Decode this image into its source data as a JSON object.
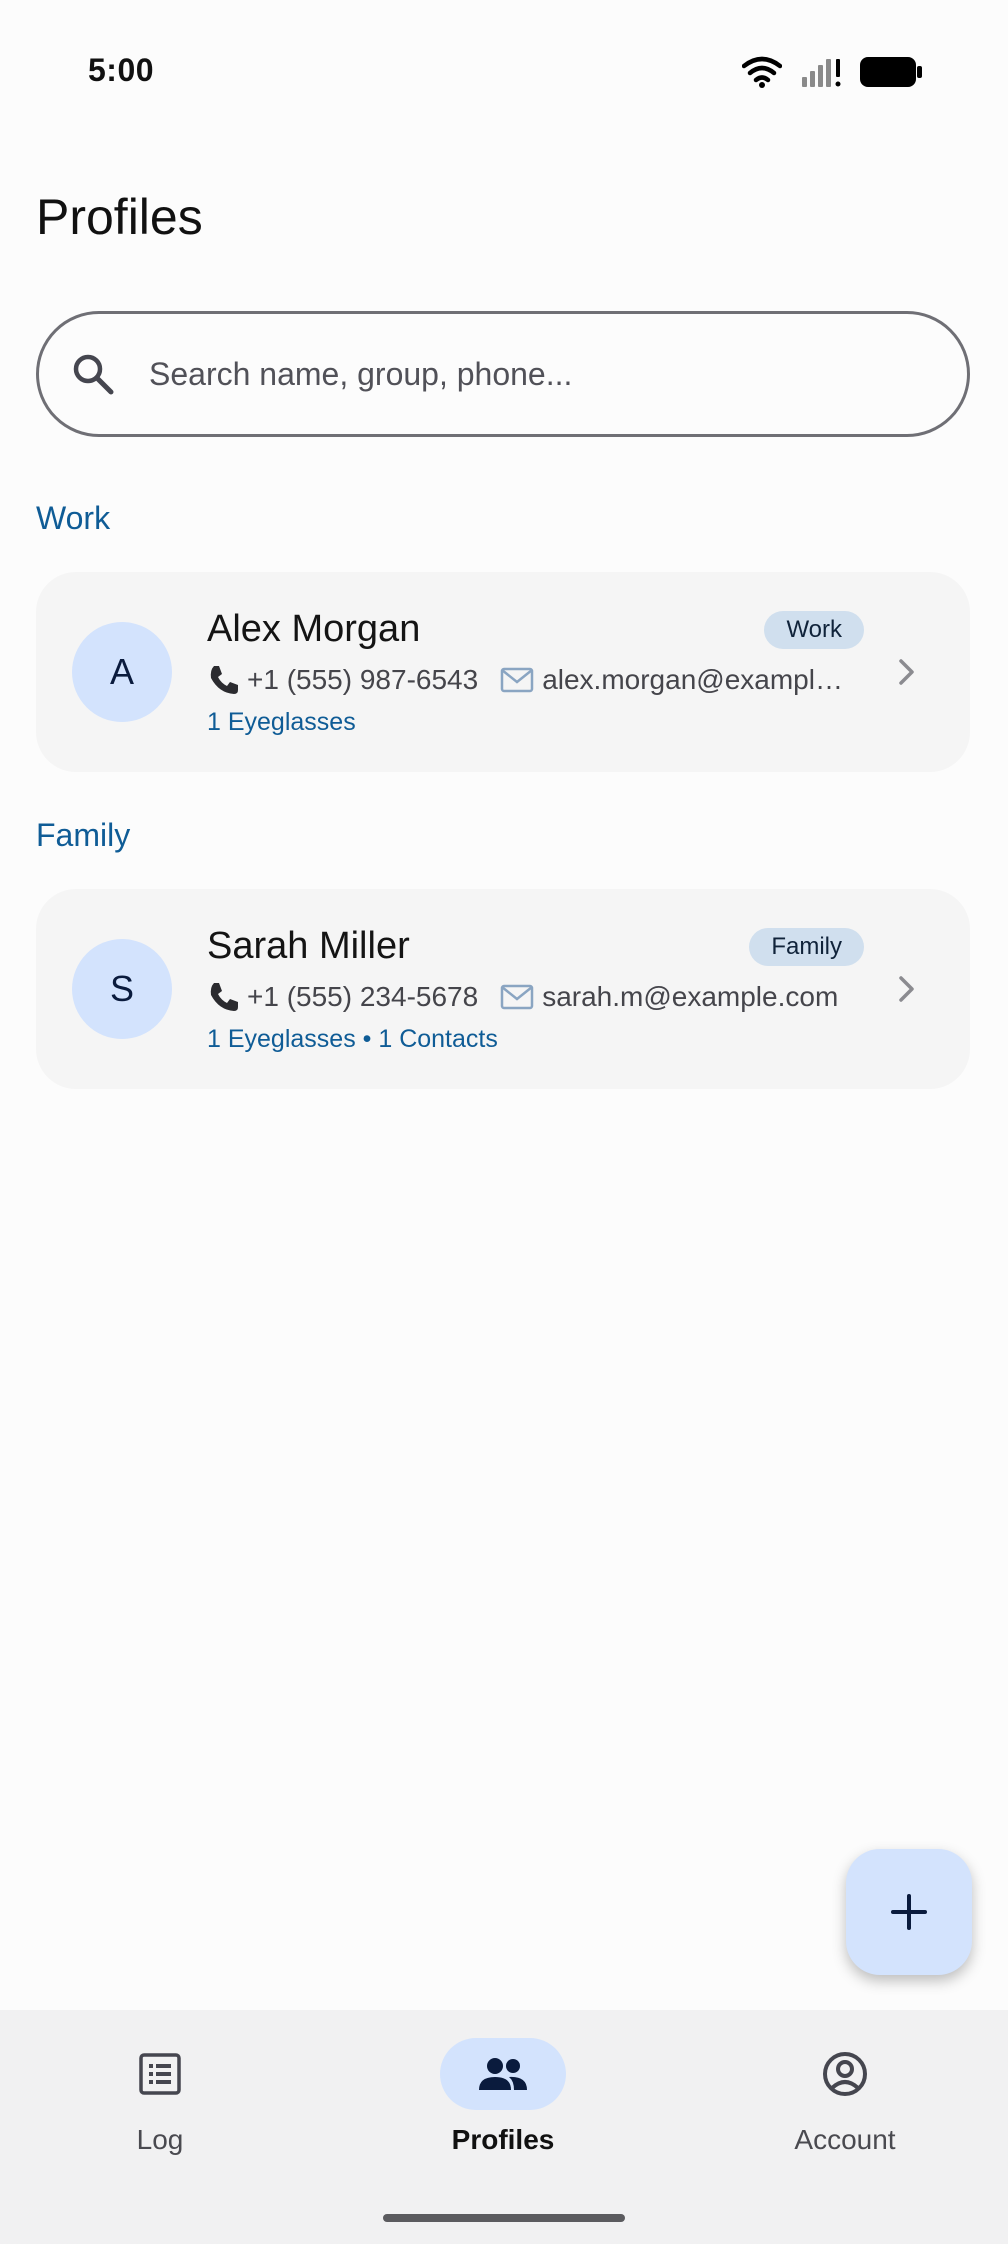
{
  "status_bar": {
    "time": "5:00"
  },
  "page": {
    "title": "Profiles"
  },
  "search": {
    "placeholder": "Search name, group, phone..."
  },
  "groups": [
    {
      "title": "Work",
      "profiles": [
        {
          "initial": "A",
          "name": "Alex Morgan",
          "badge": "Work",
          "phone": "+1 (555) 987-6543",
          "email": "alex.morgan@example.com",
          "summary": "1 Eyeglasses"
        }
      ]
    },
    {
      "title": "Family",
      "profiles": [
        {
          "initial": "S",
          "name": "Sarah Miller",
          "badge": "Family",
          "phone": "+1 (555) 234-5678",
          "email": "sarah.m@example.com",
          "summary": "1 Eyeglasses • 1 Contacts"
        }
      ]
    }
  ],
  "fab": {
    "icon": "add-icon"
  },
  "nav": {
    "items": [
      {
        "label": "Log",
        "icon": "list-icon",
        "active": false
      },
      {
        "label": "Profiles",
        "icon": "people-icon",
        "active": true
      },
      {
        "label": "Account",
        "icon": "account-circle-icon",
        "active": false
      }
    ]
  },
  "colors": {
    "accent": "#0f5c96",
    "chip_bg": "#d3e3fd",
    "card_bg": "#f5f5f5"
  }
}
